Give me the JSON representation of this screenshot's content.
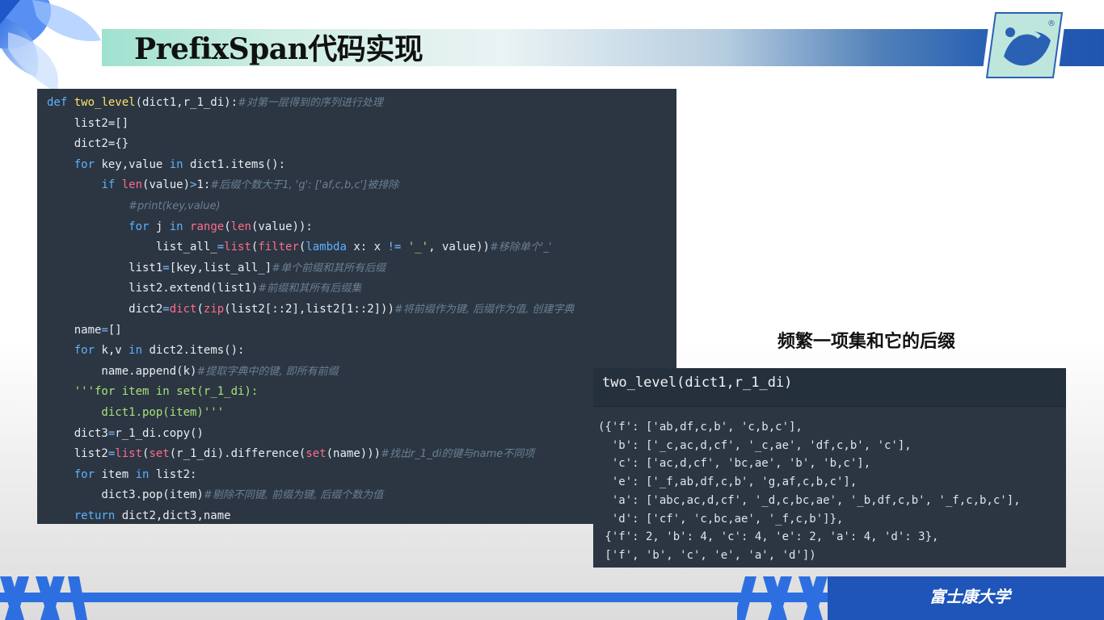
{
  "slide": {
    "title": "PrefixSpan代码实现",
    "caption": "频繁一项集和它的后缀",
    "footer_text": "富士康大学"
  },
  "code_lines": [
    "def two_level(dict1,r_1_di):#对第一层得到的序列进行处理",
    "    list2=[]",
    "    dict2={}",
    "    for key,value in dict1.items():",
    "        if len(value)>1:#后缀个数大于1, 'g': ['af,c,b,c']被排除",
    "            #print(key,value)",
    "            for j in range(len(value)):",
    "                list_all_=list(filter(lambda x: x != '_', value))#移除单个'_'",
    "            list1=[key,list_all_]#单个前缀和其所有后缀",
    "            list2.extend(list1)#前缀和其所有后缀集",
    "            dict2=dict(zip(list2[::2],list2[1::2]))#将前缀作为键, 后缀作为值, 创建字典",
    "    name=[]",
    "    for k,v in dict2.items():",
    "        name.append(k)#提取字典中的键, 即所有前缀",
    "    '''for item in set(r_1_di):",
    "        dict1.pop(item)'''",
    "    dict3=r_1_di.copy()",
    "    list2=list(set(r_1_di).difference(set(name)))#找出r_1_di的键与name不同项",
    "    for item in list2:",
    "        dict3.pop(item)#剔除不同键, 前缀为键, 后缀个数为值",
    "    return dict2,dict3,name"
  ],
  "output": {
    "header": "two_level(dict1,r_1_di)",
    "lines": [
      "({'f': ['ab,df,c,b', 'c,b,c'],",
      "  'b': ['_c,ac,d,cf', '_c,ae', 'df,c,b', 'c'],",
      "  'c': ['ac,d,cf', 'bc,ae', 'b', 'b,c'],",
      "  'e': ['_f,ab,df,c,b', 'g,af,c,b,c'],",
      "  'a': ['abc,ac,d,cf', '_d,c,bc,ae', '_b,df,c,b', '_f,c,b,c'],",
      "  'd': ['cf', 'c,bc,ae', '_f,c,b']},",
      " {'f': 2, 'b': 4, 'c': 4, 'e': 2, 'a': 4, 'd': 3},",
      " ['f', 'b', 'c', 'e', 'a', 'd'])"
    ]
  },
  "colors": {
    "code_bg": "#2b3642",
    "keyword": "#5fb0ff",
    "function_name": "#ffe16b",
    "builtin": "#ff6b8a",
    "string": "#a9e07a",
    "comment": "#6b7f94",
    "brand_blue": "#1f55b8"
  },
  "icons": {
    "logo": "university-logo-icon",
    "petals": "blue-petal-decoration",
    "footer_stripes": "zigzag-stripe-decoration"
  }
}
